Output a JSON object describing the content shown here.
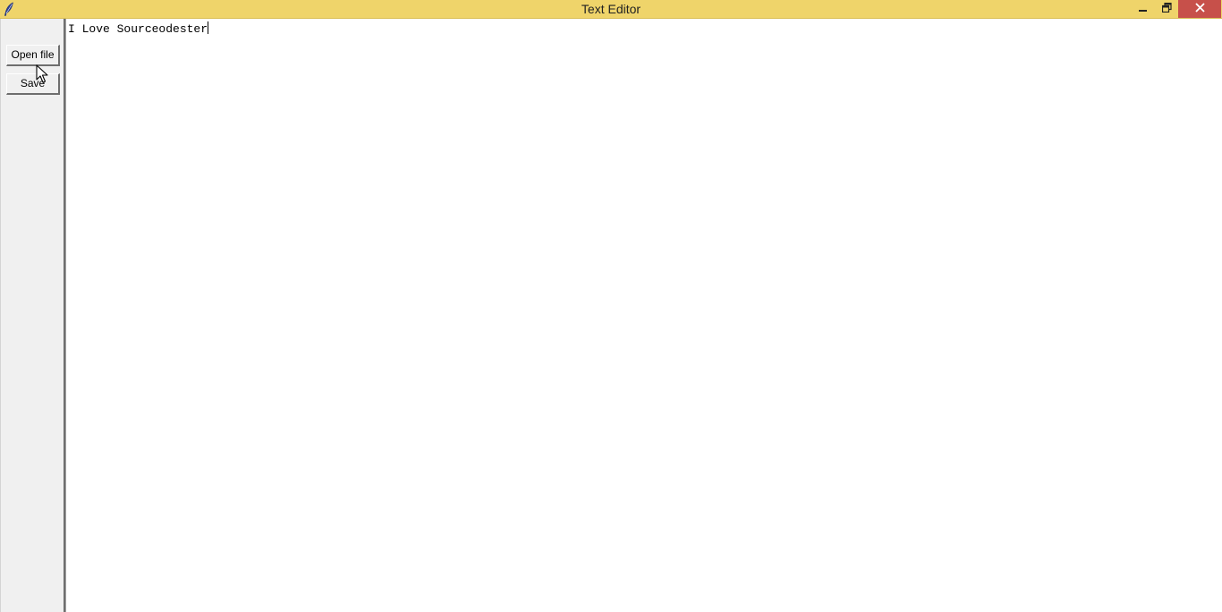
{
  "window": {
    "title": "Text Editor",
    "app_icon": "feather-icon",
    "controls": {
      "minimize_icon": "minimize-icon",
      "restore_icon": "restore-icon",
      "close_icon": "close-icon"
    },
    "colors": {
      "titlebar": "#efd46a",
      "close": "#c7504a"
    }
  },
  "sidebar": {
    "open_label": "Open file",
    "save_label": "Save"
  },
  "editor": {
    "content": "I Love Sourceodester"
  }
}
